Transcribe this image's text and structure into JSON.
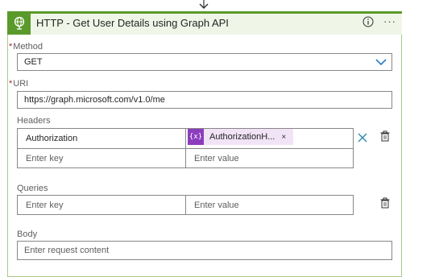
{
  "action": {
    "title": "HTTP - Get User Details using Graph API",
    "accent_color": "#5a9a2a",
    "icons": {
      "logo": "globe-icon",
      "info": "info-icon",
      "more": "ellipsis-icon"
    },
    "more_label": "···"
  },
  "method": {
    "required_mark": "*",
    "label": "Method",
    "value": "GET"
  },
  "uri": {
    "required_mark": "*",
    "label": "URI",
    "value": "https://graph.microsoft.com/v1.0/me"
  },
  "headers": {
    "label": "Headers",
    "rows": [
      {
        "key": "Authorization",
        "value_token": {
          "icon_label": "{x}",
          "text": "AuthorizationH...",
          "close_label": "×"
        }
      },
      {
        "key_placeholder": "Enter key",
        "value_placeholder": "Enter value"
      }
    ]
  },
  "queries": {
    "label": "Queries",
    "rows": [
      {
        "key_placeholder": "Enter key",
        "value_placeholder": "Enter value"
      }
    ]
  },
  "body": {
    "label": "Body",
    "placeholder": "Enter request content"
  }
}
